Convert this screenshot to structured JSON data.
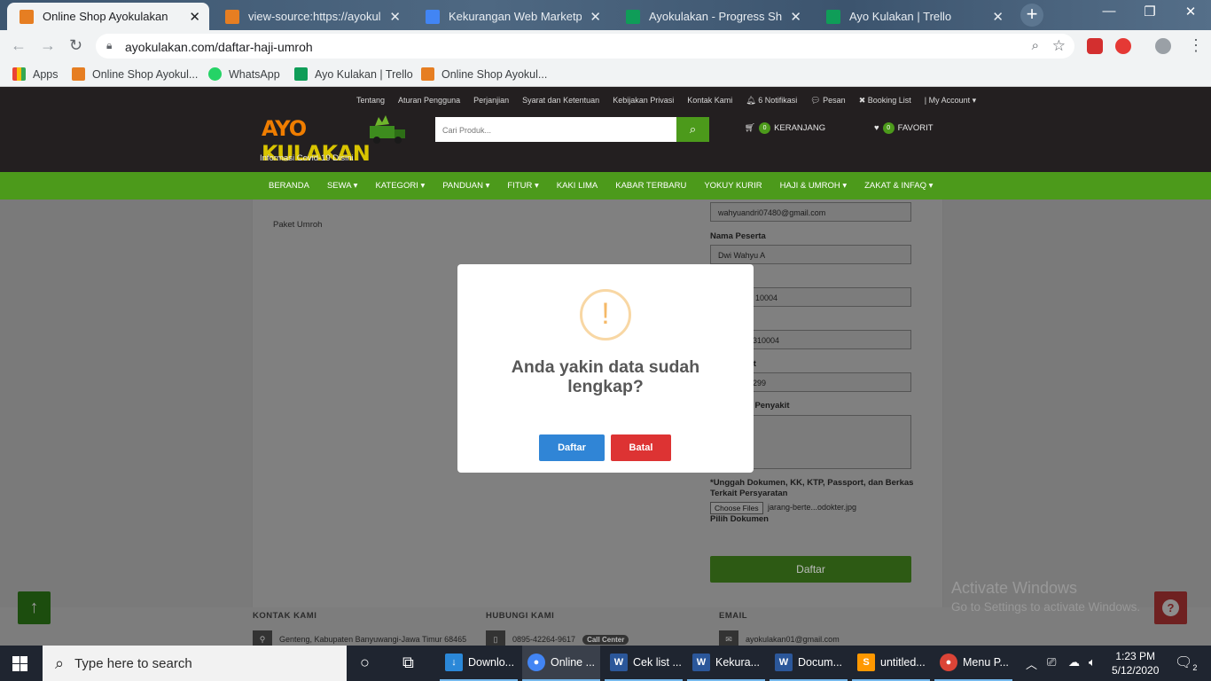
{
  "browser": {
    "tabs": [
      {
        "title": "Online Shop Ayokulakan",
        "active": true,
        "favicon_color": "#e67e22"
      },
      {
        "title": "view-source:https://ayokulakan",
        "active": false,
        "favicon_color": "#e67e22"
      },
      {
        "title": "Kekurangan Web Marketplace",
        "active": false,
        "favicon_color": "#4285f4"
      },
      {
        "title": "Ayokulakan - Progress Sheet",
        "active": false,
        "favicon_color": "#0f9d58"
      },
      {
        "title": "Ayo Kulakan | Trello",
        "active": false,
        "favicon_color": "#0f9d58"
      }
    ],
    "url": "ayokulakan.com/daftar-haji-umroh",
    "bookmarks": [
      "Apps",
      "Online Shop Ayokul...",
      "WhatsApp",
      "Ayo Kulakan | Trello",
      "Online Shop Ayokul..."
    ]
  },
  "site": {
    "top_links": [
      "Tentang",
      "Aturan Pengguna",
      "Perjanjian",
      "Syarat dan Ketentuan",
      "Kebijakan Privasi",
      "Kontak Kami",
      "6 Notifikasi",
      "Pesan",
      "Booking List",
      "| My Account"
    ],
    "logo_text_a": "AYO ",
    "logo_text_b": "KULAKAN",
    "covid_link": "Informasi Covid-19 Disini",
    "search_placeholder": "Cari Produk...",
    "cart": {
      "count": "0",
      "label": "KERANJANG"
    },
    "favorite": {
      "count": "0",
      "label": "FAVORIT"
    },
    "nav": [
      "BERANDA",
      "SEWA ▾",
      "KATEGORI ▾",
      "PANDUAN ▾",
      "FITUR ▾",
      "KAKI LIMA",
      "KABAR TERBARU",
      "YOKUY KURIR",
      "HAJI & UMROH ▾",
      "ZAKAT & INFAQ ▾"
    ]
  },
  "form": {
    "left_item": "Paket Umroh",
    "email_value": "wahyuandri07480@gmail.com",
    "nama_label": "Nama Peserta",
    "nama_value": "Dwi Wahyu A",
    "field3_value": "10004",
    "field4_value": "310004",
    "field5_label": "rt",
    "field5_value": "299",
    "penyakit_label": "n Penyakit",
    "upload_label": "*Unggah Dokumen, KK, KTP, Passport, dan Berkas Terkait Persyaratan",
    "choose_files": "Choose Files",
    "file_name": "jarang-berte...odokter.jpg",
    "pilih_dokumen": "Pilih Dokumen",
    "submit_label": "Daftar"
  },
  "footer": {
    "kontak_title": "KONTAK KAMI",
    "kontak_address": "Genteng, Kabupaten Banyuwangi-Jawa Timur 68465",
    "hubungi_title": "HUBUNGI KAMI",
    "hubungi_phone": "0895-42264-9617",
    "call_center": "Call Center",
    "email_title": "EMAIL",
    "email_value": "ayokulakan01@gmail.com"
  },
  "watermark": {
    "line1": "Activate Windows",
    "line2": "Go to Settings to activate Windows."
  },
  "modal": {
    "icon": "!",
    "title": "Anda yakin data sudah lengkap?",
    "confirm": "Daftar",
    "cancel": "Batal"
  },
  "taskbar": {
    "search_placeholder": "Type here to search",
    "apps": [
      {
        "label": "Downlo...",
        "icon": "↓",
        "color": "#2b88d8",
        "active": false
      },
      {
        "label": "Online ...",
        "icon": "●",
        "color": "#4285f4",
        "active": true
      },
      {
        "label": "Cek list ...",
        "icon": "W",
        "color": "#2b579a",
        "active": false
      },
      {
        "label": "Kekura...",
        "icon": "W",
        "color": "#2b579a",
        "active": false
      },
      {
        "label": "Docum...",
        "icon": "W",
        "color": "#2b579a",
        "active": false
      },
      {
        "label": "untitled...",
        "icon": "S",
        "color": "#ff9800",
        "active": false
      },
      {
        "label": "Menu P...",
        "icon": "●",
        "color": "#db4437",
        "active": false
      }
    ],
    "time": "1:23 PM",
    "date": "5/12/2020",
    "notifications": "2"
  }
}
